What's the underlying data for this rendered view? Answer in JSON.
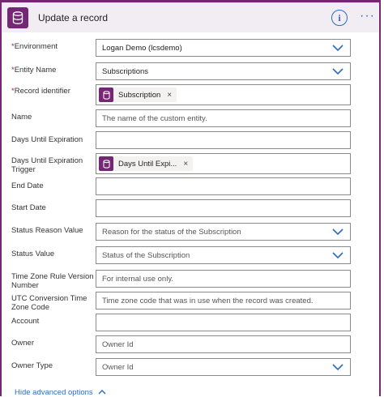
{
  "header": {
    "title": "Update a record",
    "app_icon": "database-icon",
    "info_icon": "info-icon",
    "info_glyph": "i",
    "more_icon": "more-icon",
    "more_glyph": "···",
    "accent_color": "#742774"
  },
  "fields": [
    {
      "label": "Environment",
      "required_mark": "*",
      "value": "Logan Demo (lcsdemo)",
      "type": "dropdown"
    },
    {
      "label": "Entity Name",
      "required_mark": "*",
      "value": "Subscriptions",
      "type": "dropdown"
    },
    {
      "label": "Record identifier",
      "required_mark": "*",
      "token": "Subscription",
      "remove_glyph": "×",
      "type": "token"
    },
    {
      "label": "Name",
      "placeholder": "The name of the custom entity.",
      "type": "text"
    },
    {
      "label": "Days Until Expiration",
      "value": "",
      "type": "text"
    },
    {
      "label": "Days Until Expiration Trigger",
      "token": "Days Until Expi...",
      "remove_glyph": "×",
      "type": "token"
    },
    {
      "label": "End Date",
      "value": "",
      "type": "text"
    },
    {
      "label": "Start Date",
      "value": "",
      "type": "text"
    },
    {
      "label": "Status Reason Value",
      "placeholder": "Reason for the status of the Subscription",
      "type": "dropdown"
    },
    {
      "label": "Status Value",
      "placeholder": "Status of the Subscription",
      "type": "dropdown"
    },
    {
      "label": "Time Zone Rule Version Number",
      "placeholder": "For internal use only.",
      "type": "text"
    },
    {
      "label": "UTC Conversion Time Zone Code",
      "placeholder": "Time zone code that was in use when the record was created.",
      "type": "text"
    },
    {
      "label": "Account",
      "value": "",
      "type": "text"
    },
    {
      "label": "Owner",
      "placeholder": "Owner Id",
      "type": "text"
    },
    {
      "label": "Owner Type",
      "placeholder": "Owner Id",
      "type": "dropdown"
    }
  ],
  "footer": {
    "advanced_link": "Hide advanced options",
    "chevron_icon": "chevron-up-icon"
  }
}
